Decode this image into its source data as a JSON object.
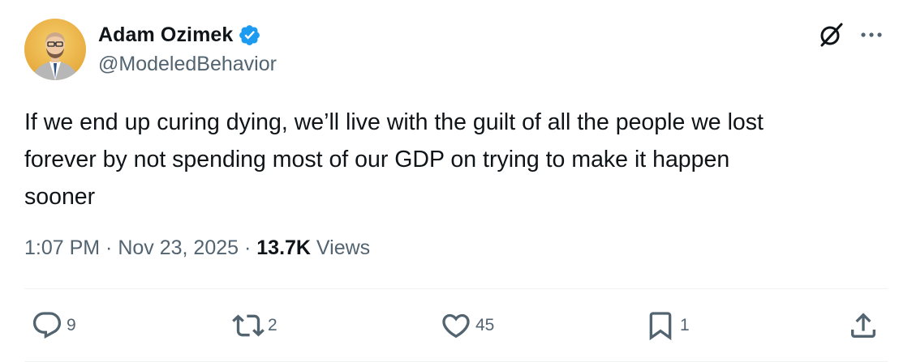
{
  "author": {
    "display_name": "Adam Ozimek",
    "handle": "@ModeledBehavior",
    "verified": true,
    "avatar": "avatar-illustration"
  },
  "tweet": {
    "text": "If we end up curing dying, we’ll live with the guilt of all the people we lost\nforever by not spending most of our GDP on trying to make it happen\nsooner",
    "time": "1:07 PM",
    "separator": " · ",
    "date": "Nov 23, 2025",
    "views_count": "13.7K",
    "views_label": " Views"
  },
  "actions": {
    "reply_count": "9",
    "retweet_count": "2",
    "like_count": "45",
    "bookmark_count": "1"
  },
  "icons": {
    "grok": "grok-icon",
    "more": "more-icon",
    "verified": "verified-badge-icon",
    "reply": "reply-icon",
    "retweet": "retweet-icon",
    "like": "heart-icon",
    "bookmark": "bookmark-icon",
    "share": "share-icon"
  },
  "colors": {
    "text_primary": "#0f1419",
    "text_secondary": "#536471",
    "verified_blue": "#1d9bf0",
    "divider": "#eff3f4"
  }
}
